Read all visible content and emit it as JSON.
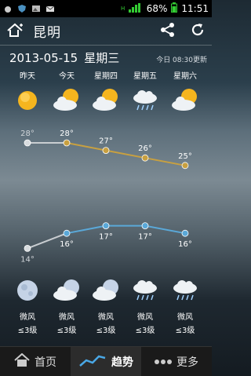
{
  "status": {
    "battery": "68%",
    "time": "11:51"
  },
  "header": {
    "city": "昆明",
    "add_icon": "home-plus-icon",
    "share_icon": "share-icon",
    "refresh_icon": "refresh-icon"
  },
  "date": {
    "date": "2013-05-15",
    "weekday": "星期三",
    "updated": "今日 08:30更新"
  },
  "days": [
    {
      "label": "昨天",
      "day_icon": "sunny",
      "night_icon": "clear-night"
    },
    {
      "label": "今天",
      "day_icon": "cloudy-sun",
      "night_icon": "cloudy-night"
    },
    {
      "label": "星期四",
      "day_icon": "cloudy-sun",
      "night_icon": "cloudy-night"
    },
    {
      "label": "星期五",
      "day_icon": "rain",
      "night_icon": "rain"
    },
    {
      "label": "星期六",
      "day_icon": "cloudy-sun",
      "night_icon": "rain"
    }
  ],
  "chart_data": {
    "type": "line",
    "x": [
      "昨天",
      "今天",
      "星期四",
      "星期五",
      "星期六"
    ],
    "series": [
      {
        "values": [
          28,
          28,
          27,
          26,
          25
        ],
        "labels": [
          "28°",
          "28°",
          "27°",
          "26°",
          "25°"
        ],
        "color": "#c8a040"
      },
      {
        "values": [
          14,
          16,
          17,
          17,
          16
        ],
        "labels": [
          "14°",
          "16°",
          "17°",
          "17°",
          "16°"
        ],
        "color": "#5aa8d8"
      }
    ]
  },
  "wind": [
    {
      "dir": "微风",
      "level": "≤3级"
    },
    {
      "dir": "微风",
      "level": "≤3级"
    },
    {
      "dir": "微风",
      "level": "≤3级"
    },
    {
      "dir": "微风",
      "level": "≤3级"
    },
    {
      "dir": "微风",
      "level": "≤3级"
    }
  ],
  "nav": {
    "home": "首页",
    "trend": "趋势",
    "more": "更多"
  }
}
